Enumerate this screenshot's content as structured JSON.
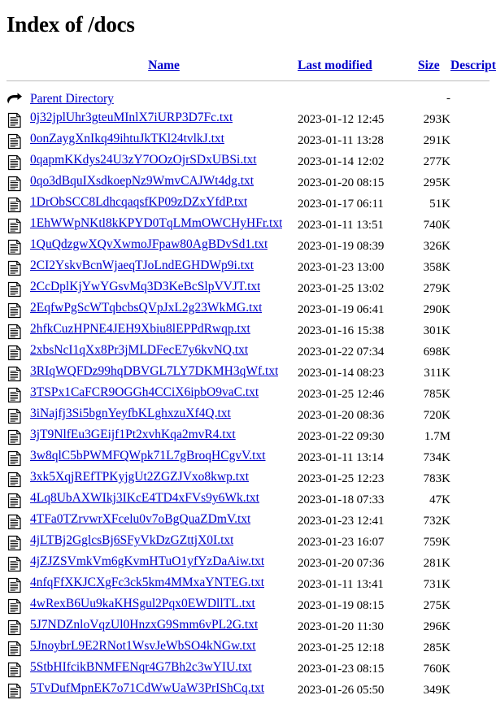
{
  "page": {
    "title": "Index of /docs"
  },
  "table": {
    "headers": {
      "icon": "",
      "name": "Name",
      "last_modified": "Last modified",
      "size": "Size",
      "description": "Description"
    },
    "parent": {
      "icon": "parent-directory-icon",
      "label": "Parent Directory",
      "last_modified": "",
      "size": "-",
      "description": ""
    },
    "rows": [
      {
        "icon": "text-file-icon",
        "name": "0j32jplUhr3gteuMInlX7iURP3D7Fc.txt",
        "last_modified": "2023-01-12 12:45",
        "size": "293K",
        "description": ""
      },
      {
        "icon": "text-file-icon",
        "name": "0onZaygXnIkq49ihtuJkTKl24tvlkJ.txt",
        "last_modified": "2023-01-11 13:28",
        "size": "291K",
        "description": ""
      },
      {
        "icon": "text-file-icon",
        "name": "0qapmKKdys24U3zY7OOzOjrSDxUBSi.txt",
        "last_modified": "2023-01-14 12:02",
        "size": "277K",
        "description": ""
      },
      {
        "icon": "text-file-icon",
        "name": "0qo3dBquIXsdkoepNz9WmvCAJWt4dg.txt",
        "last_modified": "2023-01-20 08:15",
        "size": "295K",
        "description": ""
      },
      {
        "icon": "text-file-icon",
        "name": "1DrObSCC8LdhcqaqsfKP09zDZxYfdP.txt",
        "last_modified": "2023-01-17 06:11",
        "size": "51K",
        "description": ""
      },
      {
        "icon": "text-file-icon",
        "name": "1EhWWpNKtl8kKPYD0TqLMmOWCHyHFr.txt",
        "last_modified": "2023-01-11 13:51",
        "size": "740K",
        "description": ""
      },
      {
        "icon": "text-file-icon",
        "name": "1QuQdzgwXQvXwmoJFpaw80AgBDvSd1.txt",
        "last_modified": "2023-01-19 08:39",
        "size": "326K",
        "description": ""
      },
      {
        "icon": "text-file-icon",
        "name": "2CI2YskvBcnWjaeqTJoLndEGHDWp9i.txt",
        "last_modified": "2023-01-23 13:00",
        "size": "358K",
        "description": ""
      },
      {
        "icon": "text-file-icon",
        "name": "2CcDplKjYwYGsvMq3D3KeBcSlpVVJT.txt",
        "last_modified": "2023-01-25 13:02",
        "size": "279K",
        "description": ""
      },
      {
        "icon": "text-file-icon",
        "name": "2EqfwPgScWTqbcbsQVpJxL2g23WkMG.txt",
        "last_modified": "2023-01-19 06:41",
        "size": "290K",
        "description": ""
      },
      {
        "icon": "text-file-icon",
        "name": "2hfkCuzHPNE4JEH9Xbiu8lEPPdRwqp.txt",
        "last_modified": "2023-01-16 15:38",
        "size": "301K",
        "description": ""
      },
      {
        "icon": "text-file-icon",
        "name": "2xbsNcI1qXx8Pr3jMLDFecE7y6kvNQ.txt",
        "last_modified": "2023-01-22 07:34",
        "size": "698K",
        "description": ""
      },
      {
        "icon": "text-file-icon",
        "name": "3RIqWQFDz99hqDBVGL7LY7DKMH3qWf.txt",
        "last_modified": "2023-01-14 08:23",
        "size": "311K",
        "description": ""
      },
      {
        "icon": "text-file-icon",
        "name": "3TSPx1CaFCR9OGGh4CCiX6ipbO9vaC.txt",
        "last_modified": "2023-01-25 12:46",
        "size": "785K",
        "description": ""
      },
      {
        "icon": "text-file-icon",
        "name": "3iNajfj3Si5bgnYeyfbKLghxzuXf4Q.txt",
        "last_modified": "2023-01-20 08:36",
        "size": "720K",
        "description": ""
      },
      {
        "icon": "text-file-icon",
        "name": "3jT9NlfEu3GEijf1Pt2xvhKqa2mvR4.txt",
        "last_modified": "2023-01-22 09:30",
        "size": "1.7M",
        "description": ""
      },
      {
        "icon": "text-file-icon",
        "name": "3w8qlC5bPWMFQWpk71L7gBroqHCgvV.txt",
        "last_modified": "2023-01-11 13:14",
        "size": "734K",
        "description": ""
      },
      {
        "icon": "text-file-icon",
        "name": "3xk5XqjREfTPKyjgUt2ZGZJVxo8kwp.txt",
        "last_modified": "2023-01-25 12:23",
        "size": "783K",
        "description": ""
      },
      {
        "icon": "text-file-icon",
        "name": "4Lq8UbAXWIkj3IKcE4TD4xFVs9y6Wk.txt",
        "last_modified": "2023-01-18 07:33",
        "size": "47K",
        "description": ""
      },
      {
        "icon": "text-file-icon",
        "name": "4TFa0TZrvwrXFcelu0v7oBgQuaZDmV.txt",
        "last_modified": "2023-01-23 12:41",
        "size": "732K",
        "description": ""
      },
      {
        "icon": "text-file-icon",
        "name": "4jLTBj2GglcsBj6SFyVkDzGZttjX0I.txt",
        "last_modified": "2023-01-23 16:07",
        "size": "759K",
        "description": ""
      },
      {
        "icon": "text-file-icon",
        "name": "4jZJZSVmkVm6gKvmHTuO1yfYzDaAiw.txt",
        "last_modified": "2023-01-20 07:36",
        "size": "281K",
        "description": ""
      },
      {
        "icon": "text-file-icon",
        "name": "4nfqFfXKJCXgFc3ck5km4MMxaYNTEG.txt",
        "last_modified": "2023-01-11 13:41",
        "size": "731K",
        "description": ""
      },
      {
        "icon": "text-file-icon",
        "name": "4wRexB6Uu9kaKHSgul2Pqx0EWDllTL.txt",
        "last_modified": "2023-01-19 08:15",
        "size": "275K",
        "description": ""
      },
      {
        "icon": "text-file-icon",
        "name": "5J7NDZnloVqzUl0HnzxG9Smm6vPL2G.txt",
        "last_modified": "2023-01-20 11:30",
        "size": "296K",
        "description": ""
      },
      {
        "icon": "text-file-icon",
        "name": "5JnoybrL9E2RNot1WsvJeWbSO4kNGw.txt",
        "last_modified": "2023-01-25 12:18",
        "size": "285K",
        "description": ""
      },
      {
        "icon": "text-file-icon",
        "name": "5StbHIfcikBNMFENqr4G7Bh2c3wYIU.txt",
        "last_modified": "2023-01-23 08:15",
        "size": "760K",
        "description": ""
      },
      {
        "icon": "text-file-icon",
        "name": "5TvDufMpnEK7o71CdWwUaW3PrIShCq.txt",
        "last_modified": "2023-01-26 05:50",
        "size": "349K",
        "description": ""
      }
    ]
  },
  "colors": {
    "link": "#0000cc",
    "text": "#000000",
    "rule": "#bbbbbb",
    "background": "#ffffff"
  }
}
